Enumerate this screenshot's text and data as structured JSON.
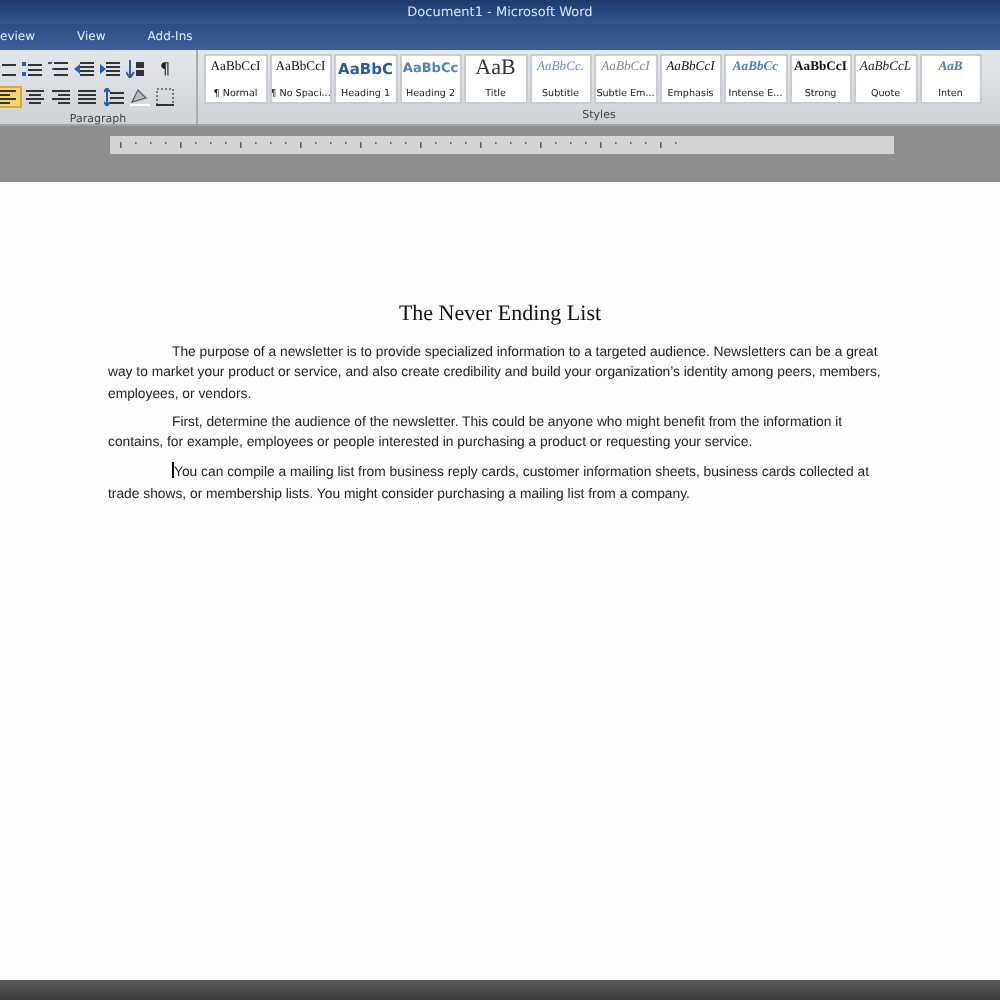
{
  "window": {
    "title": "Document1 - Microsoft Word"
  },
  "tabs": [
    {
      "label": "eview",
      "selected": false
    },
    {
      "label": "View",
      "selected": false
    },
    {
      "label": "Add-Ins",
      "selected": false
    }
  ],
  "paragraph_group": {
    "label": "Paragraph",
    "show_marks": "¶",
    "align_buttons": [
      {
        "selected": true
      },
      {
        "selected": false
      },
      {
        "selected": false
      },
      {
        "selected": false
      }
    ]
  },
  "styles_group": {
    "label": "Styles",
    "styles": [
      {
        "preview": "AaBbCcI",
        "name": "¶ Normal",
        "kind": "normal"
      },
      {
        "preview": "AaBbCcI",
        "name": "¶ No Spaci...",
        "kind": "normal"
      },
      {
        "preview": "AaBbC",
        "name": "Heading 1",
        "kind": "heading1"
      },
      {
        "preview": "AaBbCc",
        "name": "Heading 2",
        "kind": "heading2"
      },
      {
        "preview": "AaB",
        "name": "Title",
        "kind": "title"
      },
      {
        "preview": "AaBbCc.",
        "name": "Subtitle",
        "kind": "subtitle"
      },
      {
        "preview": "AaBbCcI",
        "name": "Subtle Em...",
        "kind": "subtle"
      },
      {
        "preview": "AaBbCcI",
        "name": "Emphasis",
        "kind": "emphasis"
      },
      {
        "preview": "AaBbCc",
        "name": "Intense E...",
        "kind": "intense"
      },
      {
        "preview": "AaBbCcI",
        "name": "Strong",
        "kind": "strong"
      },
      {
        "preview": "AaBbCcL",
        "name": "Quote",
        "kind": "quote"
      },
      {
        "preview": "AaB",
        "name": "Inten",
        "kind": "intense"
      }
    ]
  },
  "document": {
    "title": "The Never Ending List",
    "paragraphs": [
      {
        "text": "The purpose of a newsletter is to provide specialized information to a targeted audience. Newsletters can be a great way to market your product or service, and also create credibility and build your organization’s identity among peers, members, employees, or vendors.",
        "cursor": false
      },
      {
        "text": "First, determine the audience of the newsletter. This could be anyone who might benefit from the information it contains, for example, employees or people interested in purchasing a product or requesting your service.",
        "cursor": false
      },
      {
        "text": "You can compile a mailing list from business reply cards, customer information sheets, business cards collected at trade shows, or membership lists. You might consider purchasing a mailing list from a company.",
        "cursor": true
      }
    ]
  }
}
